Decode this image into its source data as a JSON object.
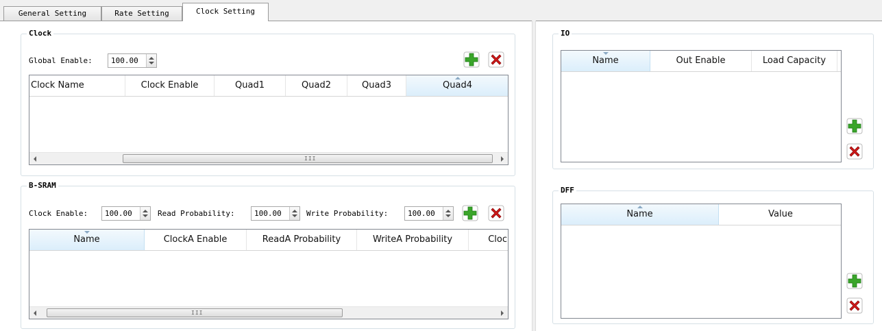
{
  "tabs": [
    {
      "label": "General Setting"
    },
    {
      "label": "Rate Setting"
    },
    {
      "label": "Clock Setting",
      "active": true
    }
  ],
  "clock": {
    "title": "Clock",
    "global_enable_label": "Global Enable:",
    "global_enable_value": "100.00",
    "columns": [
      "Clock Name",
      "Clock Enable",
      "Quad1",
      "Quad2",
      "Quad3",
      "Quad4"
    ],
    "sorted_column": "Quad4",
    "rows": []
  },
  "bsram": {
    "title": "B-SRAM",
    "clock_enable_label": "Clock Enable:",
    "clock_enable_value": "100.00",
    "read_prob_label": "Read Probability:",
    "read_prob_value": "100.00",
    "write_prob_label": "Write Probability:",
    "write_prob_value": "100.00",
    "columns": [
      "Name",
      "ClockA Enable",
      "ReadA Probability",
      "WriteA Probability",
      "Cloc"
    ],
    "sorted_column": "Name",
    "rows": []
  },
  "io": {
    "title": "IO",
    "columns": [
      "Name",
      "Out Enable",
      "Load Capacity"
    ],
    "sorted_column": "Name",
    "rows": []
  },
  "dff": {
    "title": "DFF",
    "columns": [
      "Name",
      "Value"
    ],
    "sorted_column": "Name",
    "rows": []
  },
  "icons": {
    "add": "add-plus-icon",
    "remove": "remove-x-icon",
    "add_color": "#3aa52a",
    "remove_color": "#d01818"
  }
}
